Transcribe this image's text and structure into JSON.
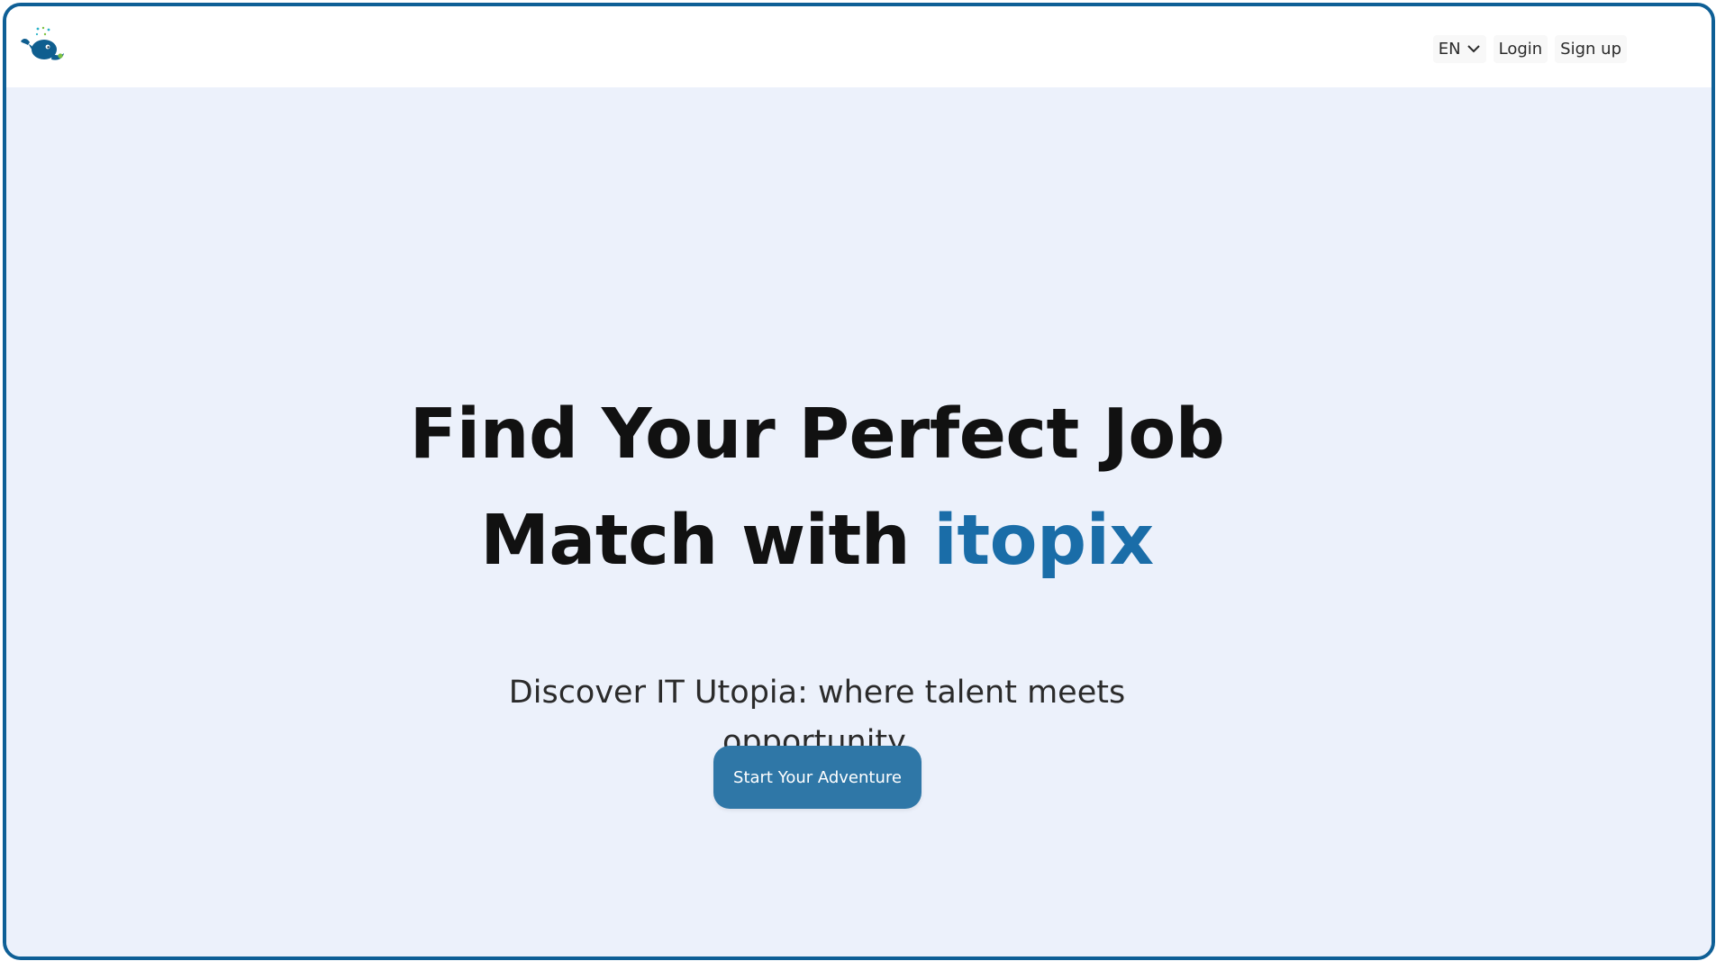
{
  "navbar": {
    "logo_icon": "whale-icon",
    "language": {
      "selected": "EN",
      "icon": "chevron-down-icon"
    },
    "login_label": "Login",
    "signup_label": "Sign up"
  },
  "hero": {
    "headline_line1": "Find Your Perfect Job",
    "headline_line2_prefix": "Match with ",
    "headline_brand": "itopix",
    "subtitle_line1": "Discover IT Utopia: where talent meets",
    "subtitle_line2": "opportunity.",
    "cta_label": "Start Your Adventure"
  },
  "colors": {
    "accent": "#1a6da8",
    "button": "#2f77a7",
    "hero_background": "#ecf1fb",
    "frame_border": "#0e5f96"
  }
}
